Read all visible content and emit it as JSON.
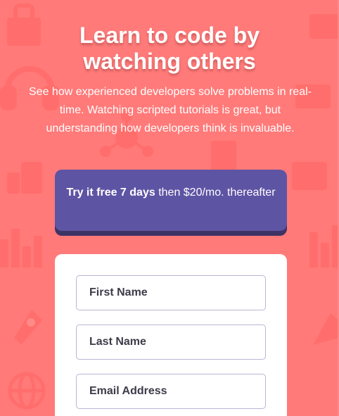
{
  "hero": {
    "title_line1": "Learn to code by",
    "title_line2": "watching others",
    "subtitle": "See how experienced developers solve problems in real-time. Watching scripted tutorials is great, but understanding how developers think is invaluable."
  },
  "trial": {
    "bold": "Try it free 7 days",
    "rest": " then $20/mo. thereafter"
  },
  "form": {
    "first_name_placeholder": "First Name",
    "last_name_placeholder": "Last Name",
    "email_placeholder": "Email Address"
  },
  "colors": {
    "background": "#ff7a79",
    "trial_box": "#5e54a4",
    "trial_shadow": "#3d3465",
    "card": "#ffffff",
    "field_border": "#b9b6d3"
  },
  "icons": [
    "bag-icon",
    "headset-icon",
    "network-icon",
    "thumbs-up-icon",
    "bar-chart-icon",
    "rocket-icon",
    "globe-icon",
    "folder-icon"
  ]
}
